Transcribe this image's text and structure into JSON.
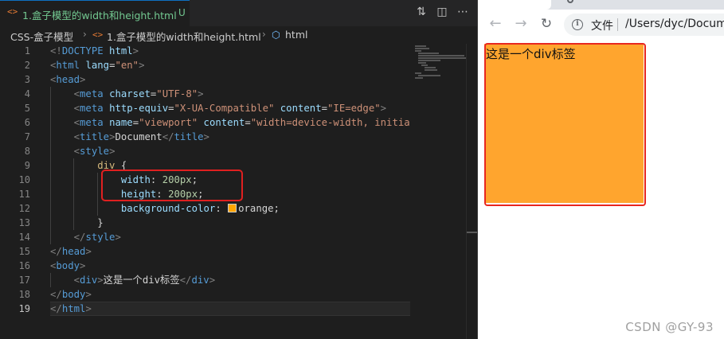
{
  "editor": {
    "tab": {
      "icon": "<>",
      "title": "1.盒子模型的width和height.html",
      "status": "U"
    },
    "actions": [
      {
        "name": "source-control-compare-icon",
        "glyph": "⇅"
      },
      {
        "name": "split-editor-icon",
        "glyph": "◫"
      },
      {
        "name": "more-actions-icon",
        "glyph": "⋯"
      }
    ],
    "breadcrumb": {
      "folder": "CSS-盒子模型",
      "sep": "›",
      "file_icon": "<>",
      "file": "1.盒子模型的width和height.html",
      "symbol_icon": "⬡",
      "symbol": "html"
    },
    "line_numbers": [
      "1",
      "2",
      "3",
      "4",
      "5",
      "6",
      "7",
      "8",
      "9",
      "10",
      "11",
      "12",
      "13",
      "14",
      "15",
      "16",
      "17",
      "18",
      "19"
    ],
    "code": {
      "l1_a": "<!",
      "l1_b": "DOCTYPE",
      "l1_c": " ",
      "l1_d": "html",
      "l1_e": ">",
      "l2_tag": "html",
      "l2_attr": "lang",
      "l2_val": "\"en\"",
      "l3_tag": "head",
      "l4_tag": "meta",
      "l4_attr": "charset",
      "l4_val": "\"UTF-8\"",
      "l5_tag": "meta",
      "l5_attr1": "http-equiv",
      "l5_val1": "\"X-UA-Compatible\"",
      "l5_attr2": "content",
      "l5_val2": "\"IE=edge\"",
      "l6_tag": "meta",
      "l6_attr1": "name",
      "l6_val1": "\"viewport\"",
      "l6_attr2": "content",
      "l6_val2": "\"width=device-width, initial-",
      "l7_tag": "title",
      "l7_text": "Document",
      "l8_tag": "style",
      "l9_sel": "div",
      "l9_brace": " {",
      "l10_prop": "width",
      "l10_val": "200px",
      "l11_prop": "height",
      "l11_val": "200px",
      "l12_prop": "background-color",
      "l12_val": "orange",
      "l13_brace": "}",
      "l14_tag": "style",
      "l15_tag": "head",
      "l16_tag": "body",
      "l17_tag": "div",
      "l17_text": "这是一个div标签",
      "l18_tag": "body",
      "l19_tag": "html"
    }
  },
  "browser": {
    "back_icon": "←",
    "forward_icon": "→",
    "reload_icon": "↻",
    "info_icon": "i",
    "file_label": "文件",
    "url": "/Users/dyc/Docum",
    "div_text": "这是一个div标签",
    "div_color": "#ffa52e"
  },
  "watermark": "CSDN @GY-93"
}
